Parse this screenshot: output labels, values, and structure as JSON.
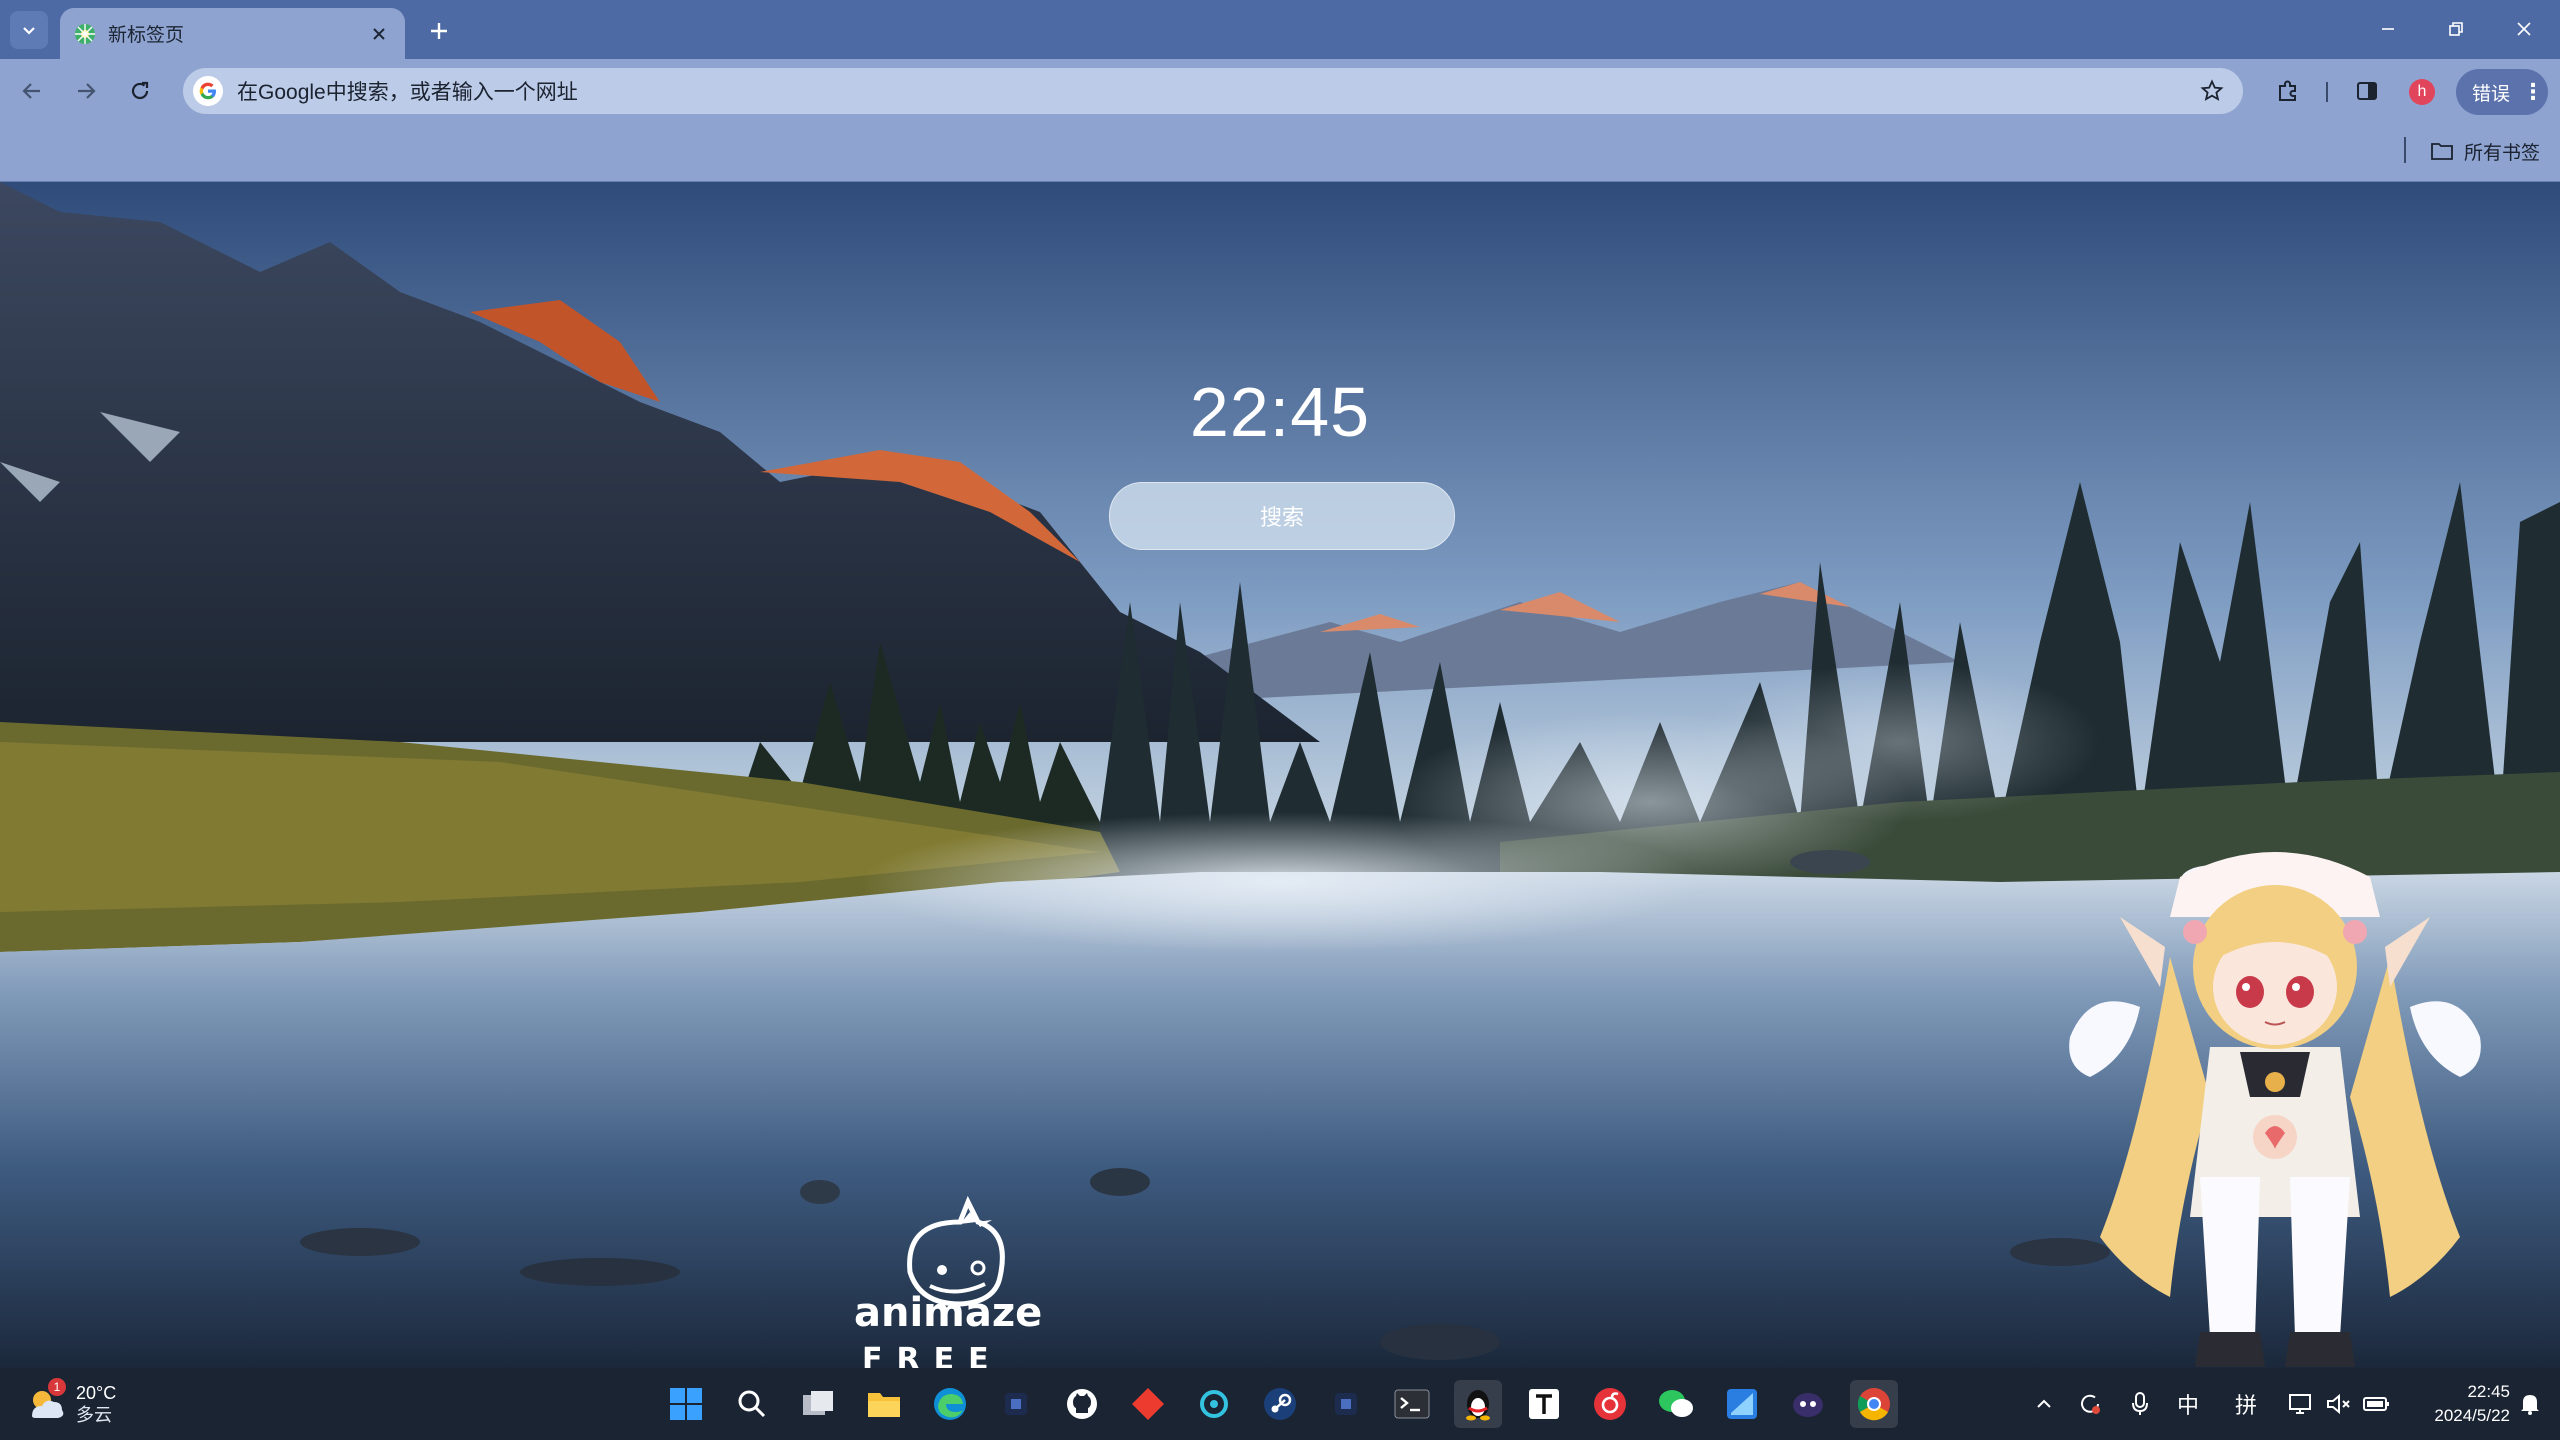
{
  "browser": {
    "tab_title": "新标签页",
    "omnibox_placeholder": "在Google中搜索，或者输入一个网址",
    "profile_initial": "h",
    "error_button_label": "错误",
    "bookmarks_all_label": "所有书签"
  },
  "page": {
    "clock_time": "22:45",
    "search_button_label": "搜索",
    "animaze_logo_text": "animaze",
    "animaze_logo_tagline": "FREE"
  },
  "taskbar": {
    "weather_badge": "1",
    "weather_temp": "20°C",
    "weather_condition": "多云",
    "pinned_apps": [
      "start",
      "search",
      "task-view",
      "file-explorer",
      "edge",
      "app",
      "github",
      "app",
      "app",
      "steam",
      "app",
      "terminal",
      "qq",
      "typora",
      "netease-music",
      "wechat",
      "app",
      "app",
      "chrome"
    ],
    "tray_ime_lang": "中",
    "tray_ime_mode": "拼",
    "time": "22:45",
    "date": "2024/5/22"
  },
  "colors": {
    "tabstrip": "#4e6aa5",
    "toolbar": "#8ea3d0",
    "omnibox": "#bccbe7",
    "taskbar": "#1b2433"
  }
}
